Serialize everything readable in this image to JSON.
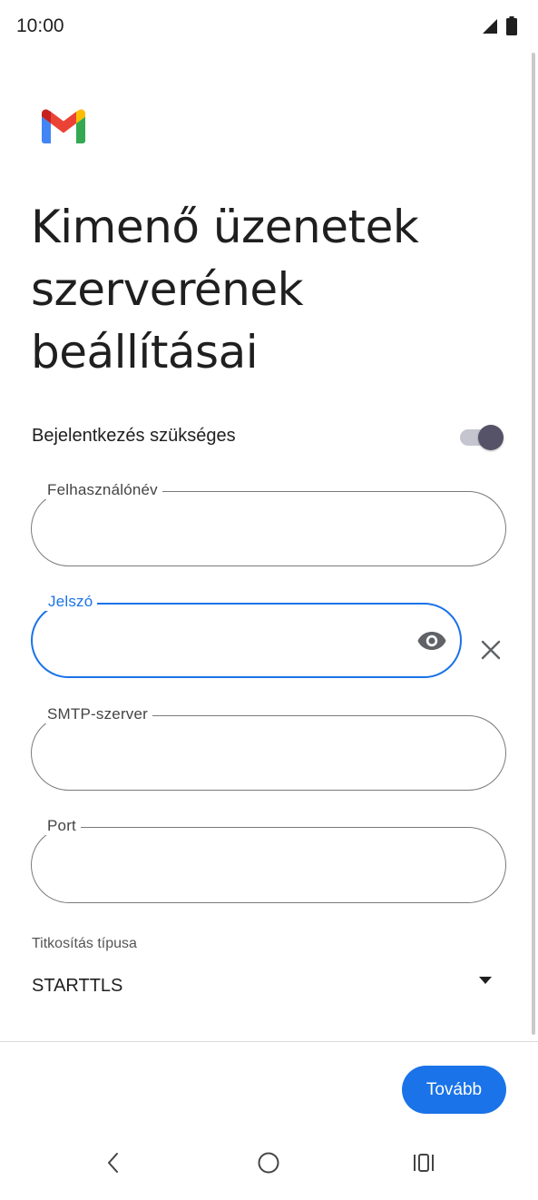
{
  "status_bar": {
    "time": "10:00"
  },
  "page": {
    "title_lines": [
      "Kimenő üzenetek",
      "szerverének",
      "beállításai"
    ]
  },
  "login_required": {
    "label": "Bejelentkezés szükséges",
    "enabled": true
  },
  "fields": {
    "username": {
      "label": "Felhasználónév",
      "value": ""
    },
    "password": {
      "label": "Jelszó",
      "value": ""
    },
    "smtp_server": {
      "label": "SMTP-szerver",
      "value": ""
    },
    "port": {
      "label": "Port",
      "value": ""
    }
  },
  "encryption": {
    "label": "Titkosítás típusa",
    "value": "STARTTLS"
  },
  "footer": {
    "next_label": "Tovább"
  },
  "colors": {
    "accent": "#1a73e8",
    "toggle_thumb": "#565268"
  },
  "icons": [
    "gmail-logo",
    "signal-icon",
    "battery-icon",
    "eye-icon",
    "clear-icon",
    "dropdown-arrow-icon",
    "nav-back-icon",
    "nav-home-icon",
    "nav-recents-icon"
  ]
}
